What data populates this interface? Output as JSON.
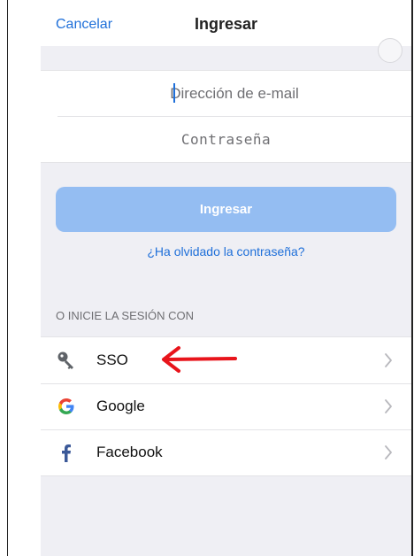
{
  "navbar": {
    "cancel_label": "Cancelar",
    "title": "Ingresar"
  },
  "form": {
    "email_placeholder": "Dirección de e-mail",
    "password_placeholder": "Contraseña"
  },
  "actions": {
    "login_label": "Ingresar",
    "forgot_label": "¿Ha olvidado la contraseña?"
  },
  "alt_login": {
    "section_label": "O INICIE LA SESIÓN CON",
    "items": [
      {
        "label": "SSO",
        "icon": "key-icon"
      },
      {
        "label": "Google",
        "icon": "google-icon"
      },
      {
        "label": "Facebook",
        "icon": "facebook-icon"
      }
    ]
  },
  "colors": {
    "accent": "#1e6fd9",
    "button_bg": "#94bdf2",
    "background": "#efeff4",
    "annotation_arrow": "#e8141b",
    "facebook": "#3b5998"
  }
}
